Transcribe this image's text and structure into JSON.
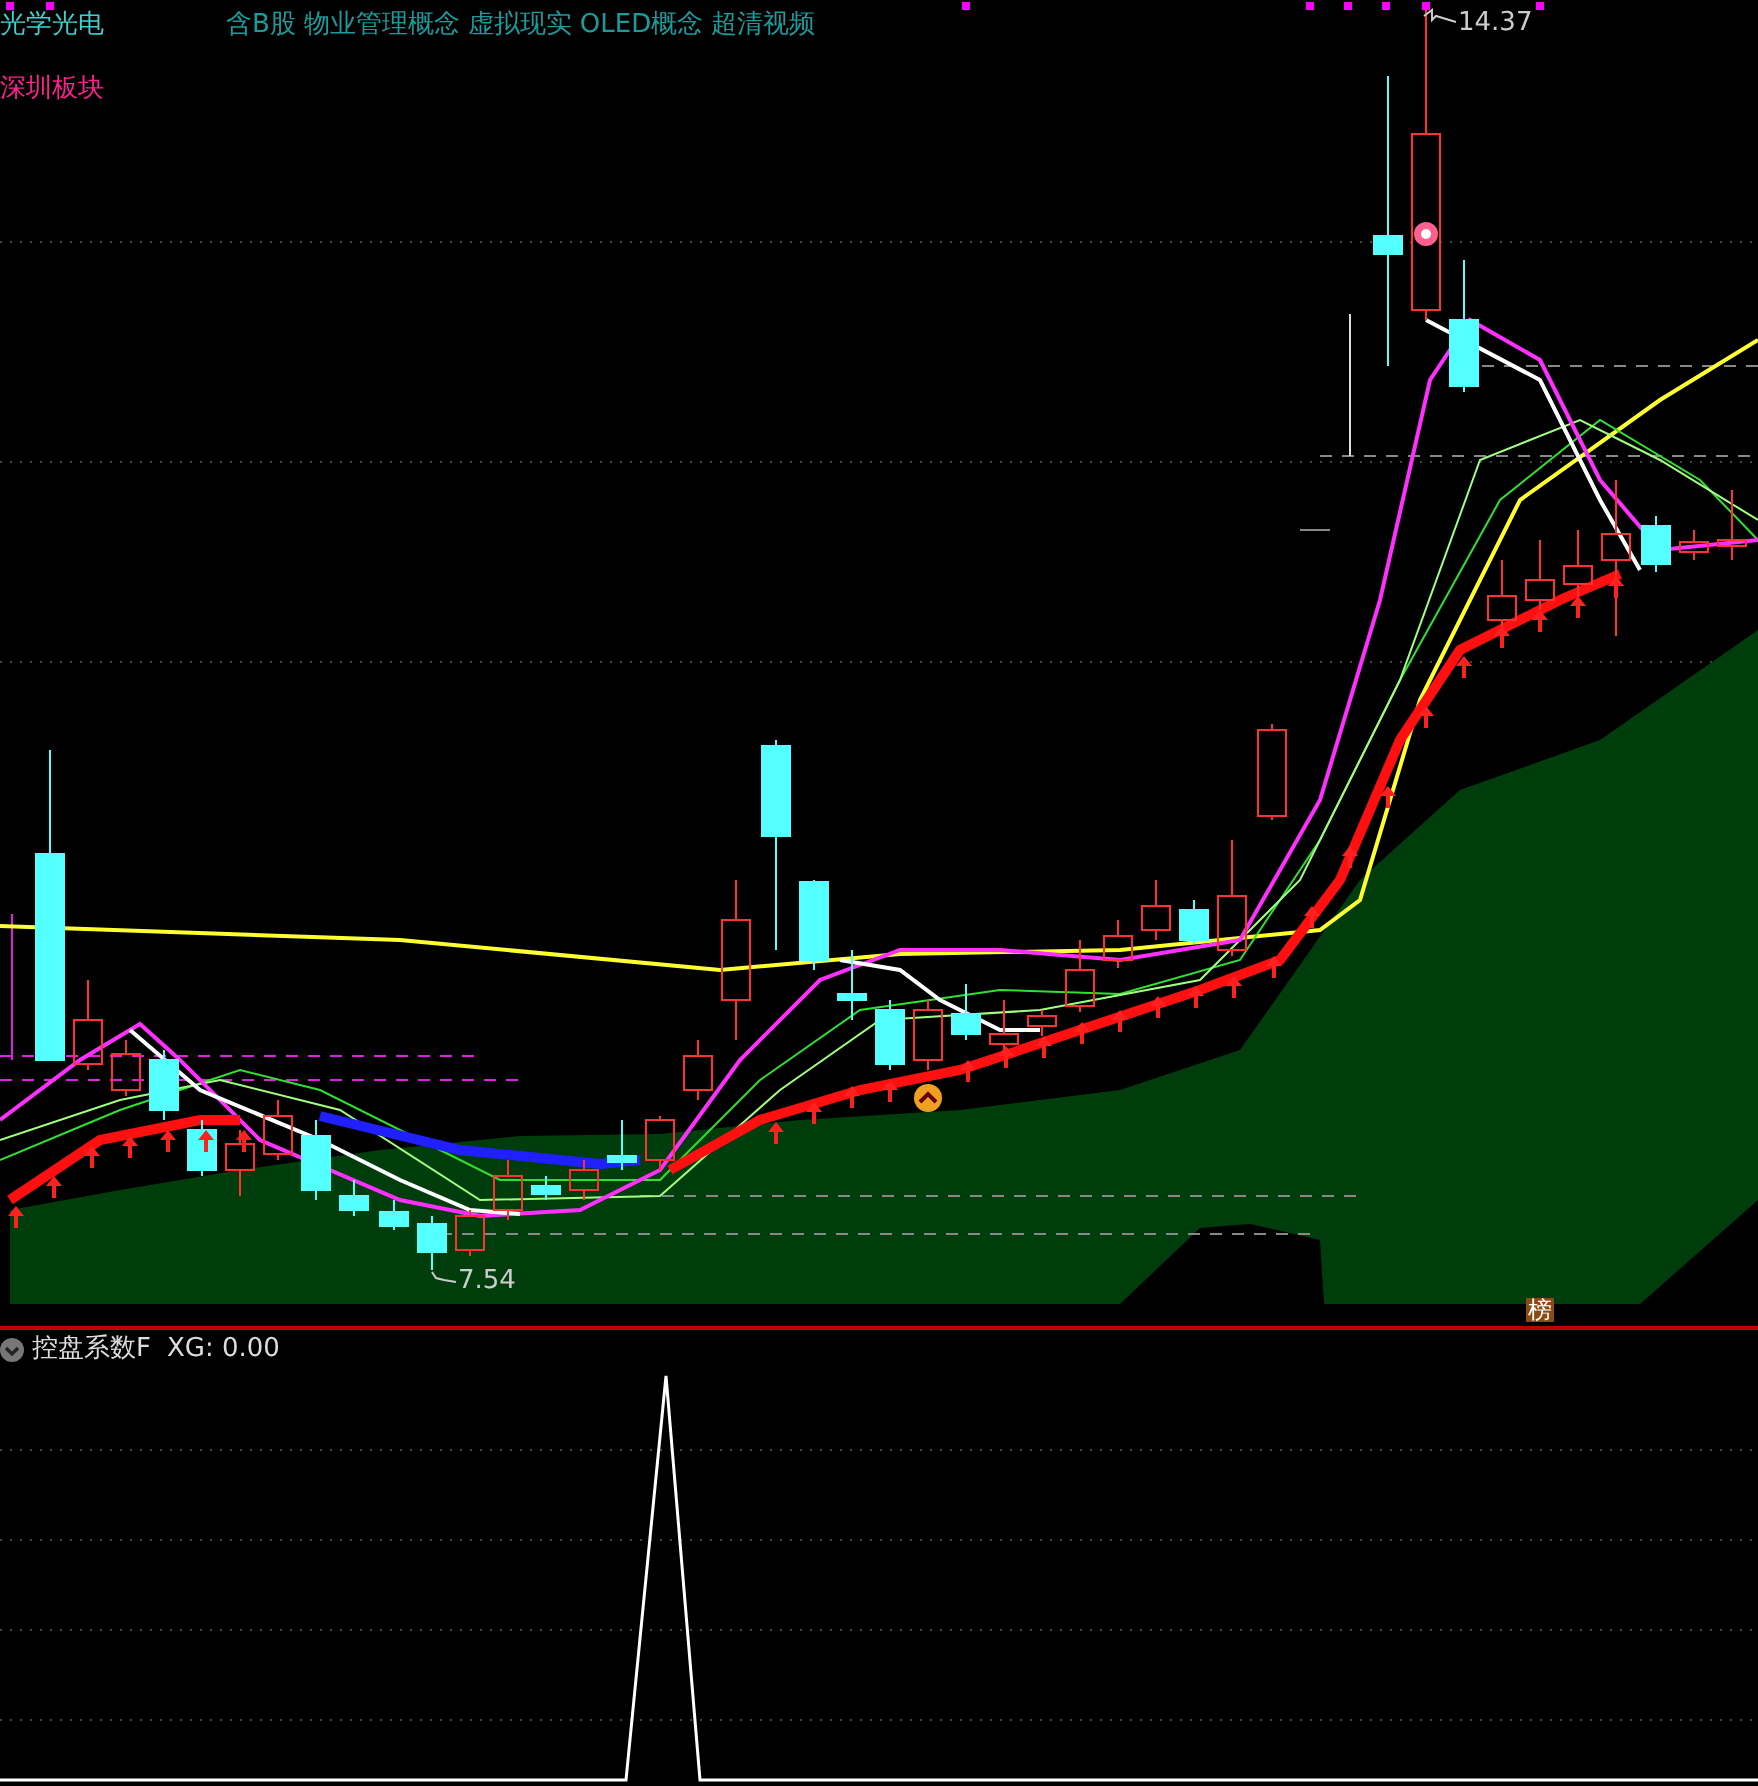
{
  "header": {
    "industry": "光学光电",
    "concepts": [
      "含B股",
      "物业管理概念",
      "虚拟现实",
      "OLED概念",
      "超清视频"
    ],
    "region": "深圳板块"
  },
  "main_chart": {
    "high_label": "14.37",
    "low_label": "7.54",
    "badge": "榜"
  },
  "indicator": {
    "name": "控盘系数F",
    "readout": "XG: 0.00"
  }
}
